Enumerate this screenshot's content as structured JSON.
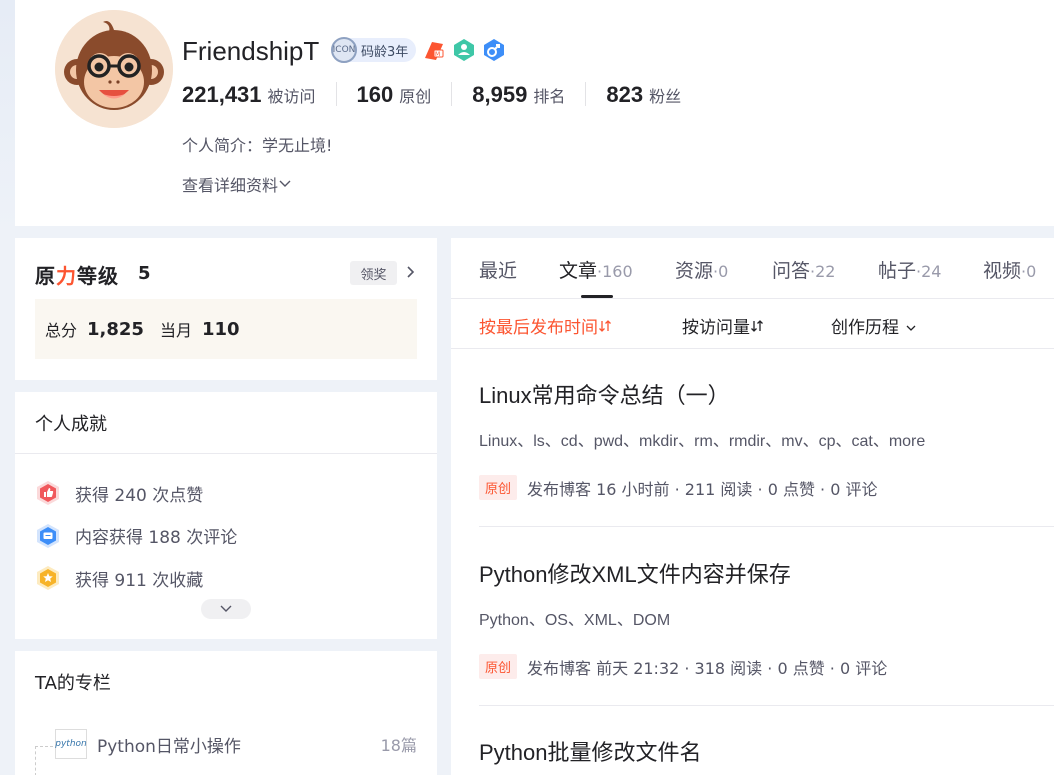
{
  "profile": {
    "username": "FriendshipT",
    "code_age": "码龄3年",
    "code_age_ring": "ICON",
    "stats": [
      {
        "value": "221,431",
        "label": "被访问"
      },
      {
        "value": "160",
        "label": "原创"
      },
      {
        "value": "8,959",
        "label": "排名"
      },
      {
        "value": "823",
        "label": "粉丝"
      }
    ],
    "bio": "个人简介：学无止境!",
    "detail_link": "查看详细资料"
  },
  "level": {
    "title_black_1": "原",
    "title_red": "力",
    "title_black_2": "等级",
    "value": "5",
    "claim": "领奖",
    "total_label": "总分",
    "total_value": "1,825",
    "month_label": "当月",
    "month_value": "110"
  },
  "achievements": {
    "title": "个人成就",
    "items": [
      {
        "text": "获得 240 次点赞",
        "icon": "thumb-icon",
        "color": "#f0585c"
      },
      {
        "text": "内容获得 188 次评论",
        "icon": "comment-icon",
        "color": "#3d8ef8"
      },
      {
        "text": "获得 911 次收藏",
        "icon": "star-icon",
        "color": "#f7b328"
      }
    ]
  },
  "columns": {
    "title": "TA的专栏",
    "items": [
      {
        "name": "Python日常小操作",
        "count": "18篇",
        "thumb": "python"
      }
    ]
  },
  "tabs": [
    {
      "label": "最近",
      "count": ""
    },
    {
      "label": "文章",
      "count": "·160"
    },
    {
      "label": "资源",
      "count": "·0"
    },
    {
      "label": "问答",
      "count": "·22"
    },
    {
      "label": "帖子",
      "count": "·24"
    },
    {
      "label": "视频",
      "count": "·0"
    }
  ],
  "sorts": {
    "latest": "按最后发布时间",
    "views": "按访问量",
    "history": "创作历程"
  },
  "articles": [
    {
      "title": "Linux常用命令总结（一）",
      "tags": "Linux、ls、cd、pwd、mkdir、rm、rmdir、mv、cp、cat、more",
      "badge": "原创",
      "meta": "发布博客 16 小时前 ·  211 阅读 ·  0 点赞 ·  0 评论"
    },
    {
      "title": "Python修改XML文件内容并保存",
      "tags": "Python、OS、XML、DOM",
      "badge": "原创",
      "meta": "发布博客 前天 21:32 ·  318 阅读 ·  0 点赞 ·  0 评论"
    },
    {
      "title": "Python批量修改文件名"
    }
  ],
  "colors": {
    "accent": "#fc5531",
    "text": "#222226",
    "muted": "#555666"
  }
}
